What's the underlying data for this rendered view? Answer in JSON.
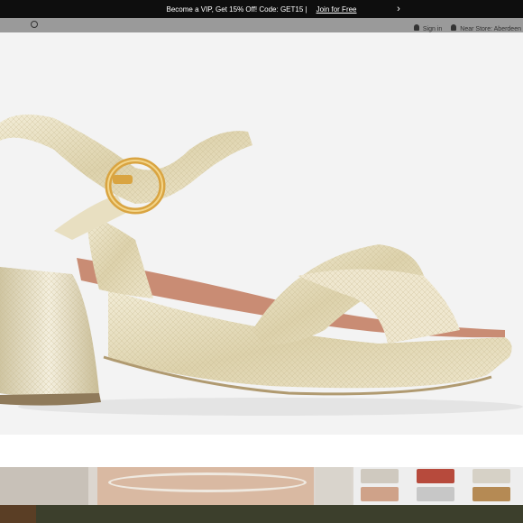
{
  "promo": {
    "text": "Become a VIP, Get 15% Off! Code: GET15 |",
    "join_label": "Join for Free",
    "next_icon": "chevron-right-icon"
  },
  "header": {
    "search_icon": "search-icon",
    "sign_in_label": "Sign in",
    "store_label": "Near Store: Aberdeen"
  },
  "product": {
    "image_subject": "metallic gold platform block-heel sandal with ankle strap and buckle"
  },
  "thumbnails": {
    "count_visible": 3
  },
  "colors": {
    "promo_bg": "#0e0e0e",
    "header_bg": "#9a9a9a",
    "stage_bg": "#f3f3f3",
    "shoe_gold": "#e8dfc1",
    "shoe_shadow": "#bfae86",
    "buckle_gold": "#d9a441",
    "lining": "#c98c74"
  }
}
